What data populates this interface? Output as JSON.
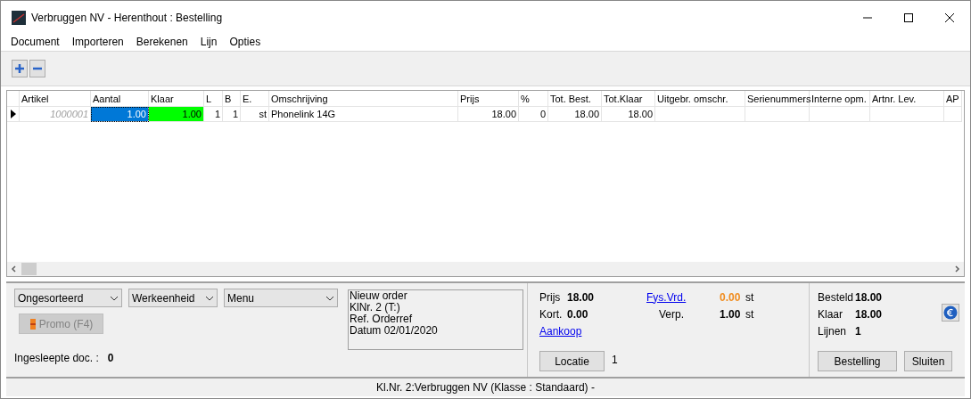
{
  "window": {
    "title": "Verbruggen NV - Herenthout : Bestelling"
  },
  "menu": [
    "Document",
    "Importeren",
    "Berekenen",
    "Lijn",
    "Opties"
  ],
  "grid": {
    "columns": [
      "Artikel",
      "Aantal",
      "Klaar",
      "L",
      "B",
      "E.",
      "Omschrijving",
      "Prijs",
      "%",
      "Tot. Best.",
      "Tot.Klaar",
      "Uitgebr. omschr.",
      "Serienummers",
      "Interne opm.",
      "Artnr. Lev.",
      "AP"
    ],
    "rows": [
      {
        "current": true,
        "cells": [
          {
            "text": "1000001",
            "selected": false,
            "highlighted": false
          },
          {
            "text": "1.00",
            "selected": true,
            "highlighted": false
          },
          {
            "text": "1.00",
            "selected": false,
            "highlighted": true
          },
          {
            "text": "1",
            "selected": false,
            "highlighted": false
          },
          {
            "text": "1",
            "selected": false,
            "highlighted": false
          },
          {
            "text": "st",
            "selected": false,
            "highlighted": false
          },
          {
            "text": "Phonelink 14G",
            "selected": false,
            "highlighted": false
          },
          {
            "text": "18.00",
            "selected": false,
            "highlighted": false
          },
          {
            "text": "0",
            "selected": false,
            "highlighted": false
          },
          {
            "text": "18.00",
            "selected": false,
            "highlighted": false
          },
          {
            "text": "18.00",
            "selected": false,
            "highlighted": false
          }
        ]
      }
    ]
  },
  "dropdowns": [
    "Ongesorteerd",
    "Werkeenheid",
    "Menu"
  ],
  "promo_button": {
    "label": "Promo (F4)",
    "disabled": true
  },
  "dragged_docs": {
    "label": "Ingesleepte doc. :",
    "value": "0"
  },
  "order_info": [
    "Nieuw order",
    "KlNr. 2 (T:)",
    "Ref. Orderref",
    "Datum 02/01/2020"
  ],
  "price": {
    "label": "Prijs",
    "value": "18.00"
  },
  "discount": {
    "label": "Kort.",
    "value": "0.00"
  },
  "phys_stock": {
    "label": "Fys.Vrd.",
    "value": "0.00",
    "unit": "st"
  },
  "packaging": {
    "label": "Verp.",
    "value": "1.00",
    "unit": "st"
  },
  "purchase_link": "Aankoop",
  "location_button": "Locatie",
  "location_value": "1",
  "totals": [
    {
      "label": "Besteld",
      "value": "18.00"
    },
    {
      "label": "Klaar",
      "value": "18.00"
    },
    {
      "label": "Lijnen",
      "value": "1"
    }
  ],
  "buttons": [
    "Bestelling",
    "Sluiten"
  ],
  "status_bar": "Kl.Nr. 2:Verbruggen NV (Klasse : Standaard) -"
}
